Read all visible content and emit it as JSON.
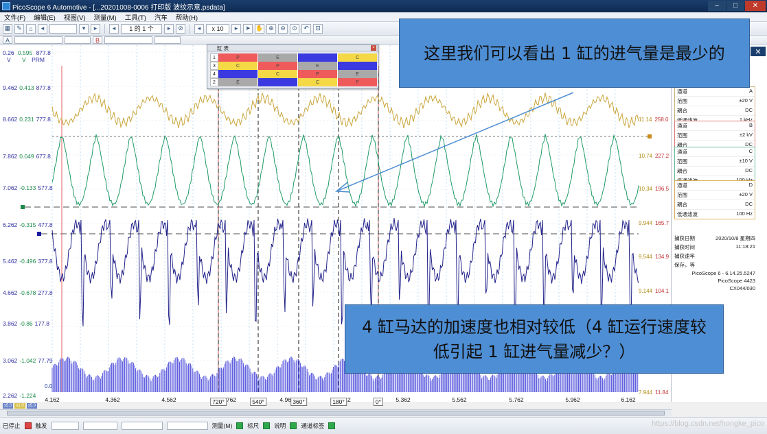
{
  "window": {
    "title": "PicoScope 6 Automotive - [...20201008-0006 打印版 波纹示意.psdata]",
    "minimize": "–",
    "maximize": "□",
    "close": "✕"
  },
  "menu": [
    "文件(F)",
    "编辑(E)",
    "视图(V)",
    "测量(M)",
    "工具(T)",
    "汽车",
    "帮助(H)"
  ],
  "toolbar": {
    "page_counter": "1 的 1 个",
    "zoom": "x 10"
  },
  "scales": {
    "top_row": [
      "0.26",
      "0.595",
      "877.8"
    ],
    "units": [
      "V",
      "V",
      "PRM"
    ],
    "left": [
      {
        "a": "9.462",
        "b": "0.413",
        "c": "877.8"
      },
      {
        "a": "8.662",
        "b": "0.231",
        "c": "777.8"
      },
      {
        "a": "7.862",
        "b": "0.049",
        "c": "677.8"
      },
      {
        "a": "7.062",
        "b": "-0.133",
        "c": "577.8"
      },
      {
        "a": "6.262",
        "b": "-0.315",
        "c": "477.8"
      },
      {
        "a": "5.462",
        "b": "-0.496",
        "c": "377.8"
      },
      {
        "a": "4.662",
        "b": "-0.678",
        "c": "277.8"
      },
      {
        "a": "3.862",
        "b": "-0.86",
        "c": "177.8"
      },
      {
        "a": "3.062",
        "b": "-1.042",
        "c": "77.79"
      },
      {
        "a": "2.262",
        "b": "-1.224",
        "c": ""
      }
    ],
    "zero_label": "0.0",
    "right": [
      {
        "a": "11.14",
        "b": "258.0"
      },
      {
        "a": "10.74",
        "b": "227.2"
      },
      {
        "a": "10.34",
        "b": "196.5"
      },
      {
        "a": "9.944",
        "b": "165.7"
      },
      {
        "a": "9.544",
        "b": "134.9"
      },
      {
        "a": "9.144",
        "b": "104.1"
      },
      {
        "a": "7.944",
        "b": "11.84"
      }
    ]
  },
  "x_axis": {
    "ticks": [
      "4.162",
      "4.362",
      "4.562",
      "762",
      "4.962",
      "62",
      "5.362",
      "5.562",
      "5.762",
      "5.962",
      "6.162"
    ],
    "angles": [
      "720°",
      "540°",
      "360°",
      "180°",
      "0°"
    ]
  },
  "cylinder_table": {
    "title": "缸 表",
    "rows": [
      {
        "num": "1",
        "cells": [
          "P",
          "E",
          "",
          "C"
        ]
      },
      {
        "num": "3",
        "cells": [
          "C",
          "P",
          "E",
          ""
        ]
      },
      {
        "num": "4",
        "cells": [
          "",
          "C",
          "P",
          "E"
        ]
      },
      {
        "num": "2",
        "cells": [
          "E",
          "",
          "C",
          "P"
        ]
      }
    ],
    "colors": {
      "P": "#ef5b5b",
      "E": "#a9a9a9",
      "C": "#f5d846",
      "": "#3a3ae0"
    }
  },
  "channels": [
    {
      "rows": [
        [
          "通道",
          "A"
        ],
        [
          "范围",
          "±20 V"
        ],
        [
          "耦合",
          "DC"
        ],
        [
          "低通滤波",
          "1 kHz"
        ]
      ],
      "color": "#c9b27a"
    },
    {
      "rows": [
        [
          "通道",
          "B"
        ],
        [
          "范围",
          "±2 kV"
        ],
        [
          "耦合",
          "DC"
        ]
      ],
      "color": "#d77"
    },
    {
      "rows": [
        [
          "通道",
          "C"
        ],
        [
          "范围",
          "±10 V"
        ],
        [
          "耦合",
          "DC"
        ],
        [
          "低通滤波",
          "100 Hz"
        ]
      ],
      "color": "#6b9"
    },
    {
      "rows": [
        [
          "通道",
          "D"
        ],
        [
          "范围",
          "±20 V"
        ],
        [
          "耦合",
          "DC"
        ],
        [
          "低通滤波",
          "100 Hz"
        ]
      ],
      "color": "#d8b25a"
    }
  ],
  "capture_info": {
    "date_label": "捕获日期",
    "date": "2020/10/8 星期四",
    "time_label": "捕获时间",
    "time": "11:18:21",
    "rate_label": "捕获速率",
    "save_label": "保存，等",
    "software": "PicoScope 6 - 6.14.25.5247",
    "device": "PicoScope 4423",
    "serial": "CX044/030"
  },
  "callouts": {
    "top": "这里我们可以看出 1 缸的进气量是最少的",
    "bottom": "4 缸马达的加速度也相对较低（4 缸运行速度较低引起 1 缸进气量减少？）"
  },
  "statusbar": {
    "stop": "已停止",
    "trigger": "触发",
    "measure": "测量(M)",
    "ruler": "标尺",
    "notes": "说明",
    "channel_labels": "通道标签"
  },
  "watermark": "https://blog.csdn.net/hongke_pico"
}
